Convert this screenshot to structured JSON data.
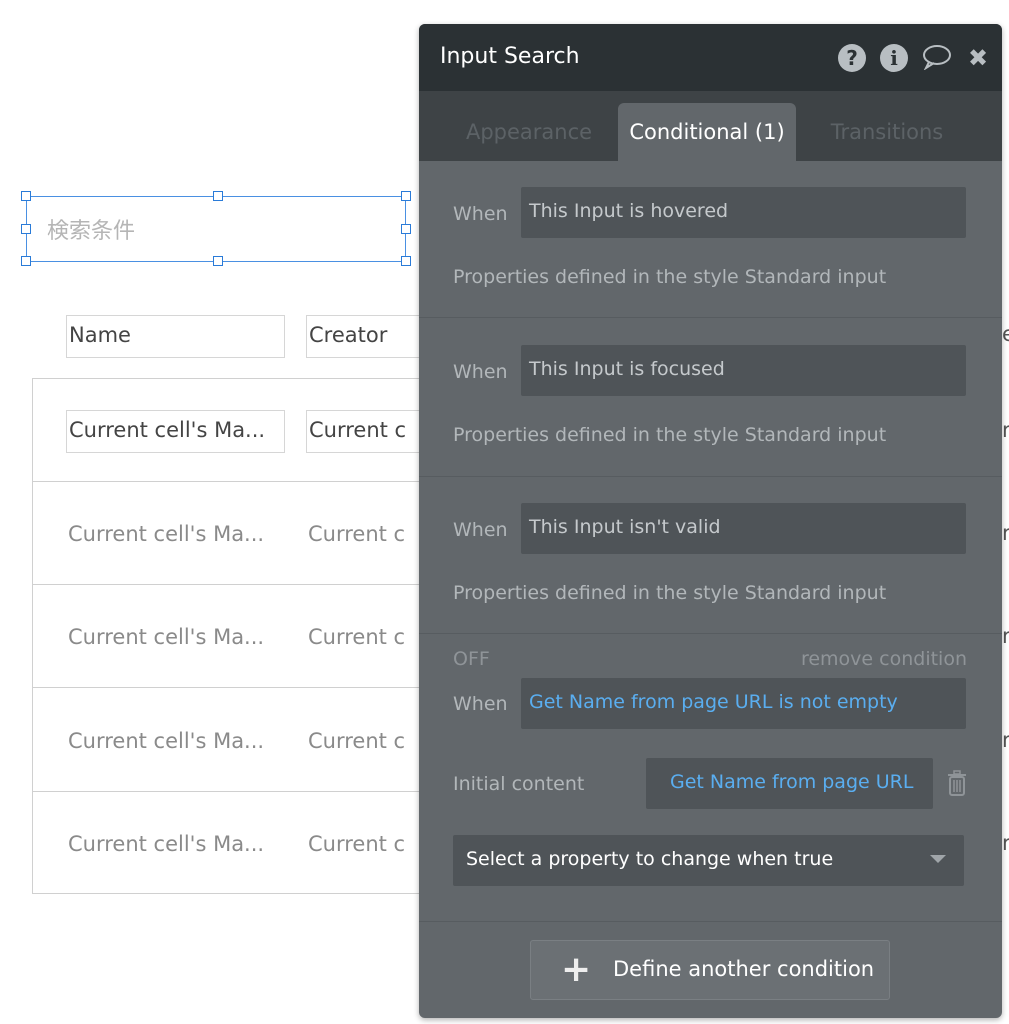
{
  "canvas": {
    "search_placeholder": "検索条件",
    "headers": [
      "Name",
      "Creator"
    ],
    "row1": [
      "Current cell's Ma...",
      "Current c"
    ],
    "rows": [
      [
        "Current cell's Ma...",
        "Current c"
      ],
      [
        "Current cell's Ma...",
        "Current c"
      ],
      [
        "Current cell's Ma...",
        "Current c"
      ],
      [
        "Current cell's Ma...",
        "Current c"
      ]
    ],
    "clipped": [
      "e",
      "r",
      "r",
      "r",
      "r",
      "r"
    ]
  },
  "panel": {
    "title": "Input Search",
    "icons": [
      "help-icon",
      "info-icon",
      "comment-icon",
      "close-icon"
    ],
    "tabs": [
      "Appearance",
      "Conditional (1)",
      "Transitions"
    ],
    "conditions": [
      {
        "when": "When",
        "expr": "This Input is hovered",
        "props": "Properties defined in the style Standard input"
      },
      {
        "when": "When",
        "expr": "This Input is focused",
        "props": "Properties defined in the style Standard input"
      },
      {
        "when": "When",
        "expr": "This Input isn't valid",
        "props": "Properties defined in the style Standard input"
      }
    ],
    "custom": {
      "off": "OFF",
      "remove": "remove condition",
      "when": "When",
      "expr": "Get Name from page URL is not empty",
      "prop_label": "Initial content",
      "prop_value": "Get Name from page URL",
      "select": "Select a property to change when true"
    },
    "add_button": "Define another condition",
    "accent": "#5aaef0"
  }
}
